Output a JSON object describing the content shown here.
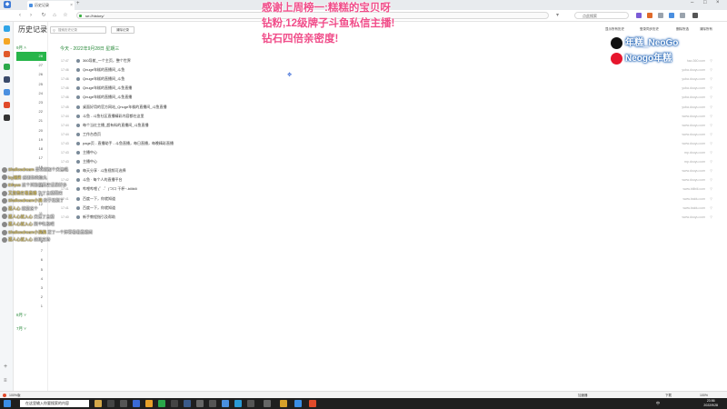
{
  "browser": {
    "tab_title": "历史记录",
    "url": "se://history/",
    "search_placeholder": "点此搜索",
    "sync_label": "登录",
    "toolbar_right": [
      "图片翻译同步",
      "同步云同步"
    ]
  },
  "header": {
    "title": "历史记录",
    "search_placeholder": "搜索历史记录",
    "clear_button": "清除记录",
    "options": [
      "显示所有历史",
      "登录同步历史",
      "删除所选",
      "清除所有"
    ]
  },
  "timeline": {
    "current_month": "9月",
    "days": [
      "28",
      "27",
      "26",
      "25",
      "24",
      "23",
      "22",
      "21",
      "20",
      "19",
      "18",
      "17",
      "16",
      "15",
      "14",
      "13",
      "12",
      "11",
      "10",
      "9",
      "8",
      "7",
      "6",
      "5",
      "4",
      "3",
      "2",
      "1"
    ],
    "active_day": "28",
    "other_months": [
      "8月",
      "7月"
    ]
  },
  "today_label": "今天 - 2022年9月28日 星期三",
  "history": [
    {
      "time": "17:47",
      "title": "360导航_一个主页，整个世界",
      "domain": "hao.360.com"
    },
    {
      "time": "17:46",
      "title": "Qnuge年糕的直播间_斗鱼",
      "domain": "yuba.douyu.com"
    },
    {
      "time": "17:46",
      "title": "Qnuge年糕的直播间_斗鱼",
      "domain": "yuba.douyu.com"
    },
    {
      "time": "17:46",
      "title": "Qnuge年糕的直播间_斗鱼直播",
      "domain": "yuba.douyu.com"
    },
    {
      "time": "17:46",
      "title": "Qnuge年糕的直播间_斗鱼直播",
      "domain": "yuba.douyu.com"
    },
    {
      "time": "17:45",
      "title": "桌面好用的官方网站_Qnuge年糕的直播间_斗鱼直播",
      "domain": "yuba.douyu.com"
    },
    {
      "time": "17:44",
      "title": "斗鱼 - 斗鱼社区直播精彩内容都在这里",
      "domain": "www.douyu.com"
    },
    {
      "time": "17:44",
      "title": "每个当红主播_超有料的直播间_斗鱼直播",
      "domain": "www.douyu.com"
    },
    {
      "time": "17:44",
      "title": "工作台首页",
      "domain": "www.douyu.com"
    },
    {
      "time": "17:43",
      "title": "page页 - 直播助手 - 斗鱼直播，每日直播，每晚精彩直播",
      "domain": "www.douyu.com"
    },
    {
      "time": "17:43",
      "title": "主播中心",
      "domain": "mp.douyu.com"
    },
    {
      "time": "17:43",
      "title": "主播中心",
      "domain": "mp.douyu.com"
    },
    {
      "time": "17:42",
      "title": "每天分享 · 斗鱼视频可选择",
      "domain": "www.douyu.com"
    },
    {
      "time": "17:42",
      "title": "斗鱼 · 每个人的直播平台",
      "domain": "www.douyu.com"
    },
    {
      "time": "17:41",
      "title": "哔哩哔哩 (゜-゜)つロ 干杯~-bilibili",
      "domain": "www.bilibili.com"
    },
    {
      "time": "17:41",
      "title": "百度一下，你就知道",
      "domain": "www.baidu.com"
    },
    {
      "time": "17:41",
      "title": "百度一下，你就知道",
      "domain": "www.baidu.com"
    },
    {
      "time": "17:40",
      "title": "新手教程指引及帮助",
      "domain": "www.douyu.com"
    }
  ],
  "danmaku": [
    {
      "name": "Shallowdream",
      "text": "喜欢就加个关注吧"
    },
    {
      "name": "lzy潮男",
      "text": "感谢你的鱼丸"
    },
    {
      "name": "Ethyus",
      "text": "这个浏览器历史记录好多"
    },
    {
      "name": "又是我在看直播",
      "text": "为了主播而来"
    },
    {
      "name": "Shallowdream小满",
      "text": "终于找到了"
    },
    {
      "name": "孤人心",
      "text": "就是这个"
    },
    {
      "name": "孤人心就入心",
      "text": "关注了主播"
    },
    {
      "name": "孤人心就入心",
      "text": "刷个礼物吧"
    },
    {
      "name": "Shallowdream小满满",
      "text": "发了一个弹幕看看直播间"
    },
    {
      "name": "孤人心就入心",
      "text": "前排支持"
    }
  ],
  "overlay": {
    "lines": [
      "感谢上周榜一:糕糕的宝贝呀",
      "钻粉,12级牌子斗鱼私信主播!",
      "钻石四倍亲密度!"
    ],
    "douyin": "年糕_NeoGo",
    "weibo": "Neogo年糕"
  },
  "statusbar": {
    "left": "100%版",
    "right": [
      "加速器",
      "下载",
      "100%"
    ]
  },
  "taskbar": {
    "search_placeholder": "在这里输入你要搜索的内容",
    "time": "23:56",
    "date": "2022/9/28",
    "lang": "中"
  },
  "colors": {
    "accent": "#27b54a",
    "overlay_pink": "#f04e8a"
  }
}
